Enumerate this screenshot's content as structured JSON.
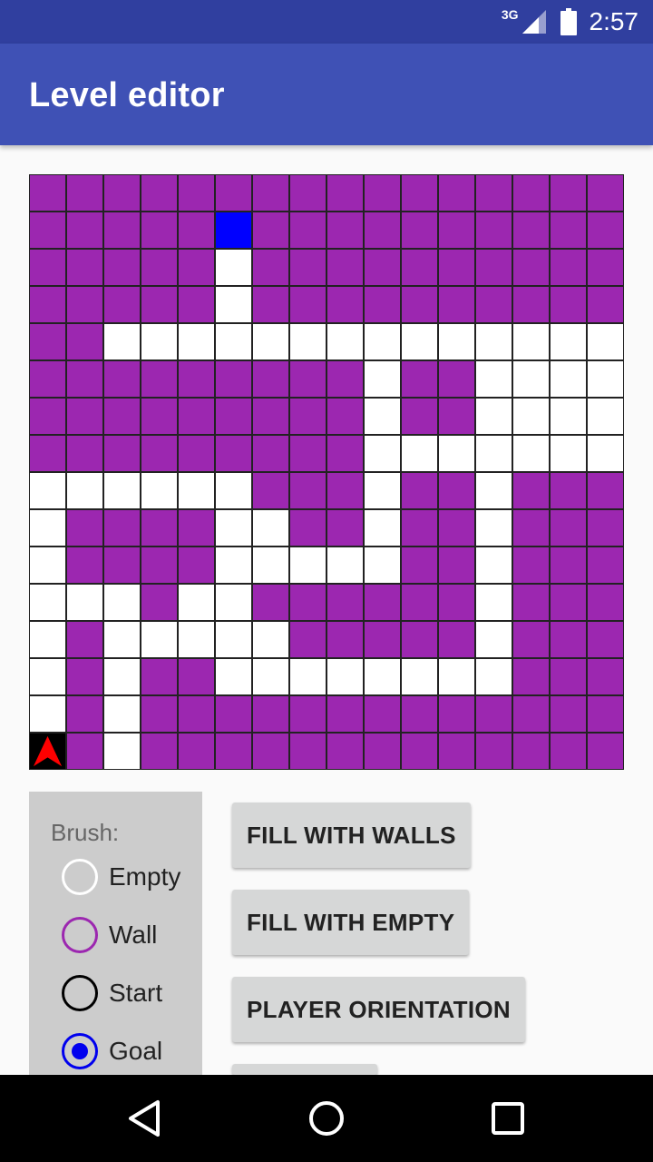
{
  "status_bar": {
    "network": "3G",
    "time": "2:57"
  },
  "app_bar": {
    "title": "Level editor"
  },
  "maze": {
    "rows": 16,
    "cols": 16,
    "legend": {
      "W": "wall",
      "E": "empty",
      "G": "goal",
      "S": "start"
    },
    "start_orientation": "up",
    "colors": {
      "wall": "#9c27b0",
      "empty": "#ffffff",
      "goal": "#0000ff",
      "start": "#000000",
      "arrow": "#ff0000"
    },
    "cells": [
      "WWWWWWWWWWWWWWWW",
      "WWWWWGWWWWWWWWWW",
      "WWWWWEWWWWWWWWWW",
      "WWWWWEWWWWWWWWWW",
      "WWEEEEEEEEEEEEEE",
      "WWWWWWWWWEWWEEEE",
      "WWWWWWWWWEWWEEEE",
      "WWWWWWWWWEEEEEEE",
      "EEEEEEWWWEWWEWWW",
      "EWWWWEEWWEWWEWWW",
      "EWWWWEEEEEWWEWWW",
      "EEEWEEWWWWWWEWWW",
      "EWEEEEEWWWWWEWWW",
      "EWEWWEEEEEEEEWWW",
      "EWEWWWWWWWWWWWWW",
      "SWEWWWWWWWWWWWWW"
    ]
  },
  "brush": {
    "label": "Brush:",
    "options": [
      {
        "label": "Empty",
        "ring_color": "#ffffff",
        "selected": false
      },
      {
        "label": "Wall",
        "ring_color": "#9c27b0",
        "selected": false
      },
      {
        "label": "Start",
        "ring_color": "#000000",
        "selected": false
      },
      {
        "label": "Goal",
        "ring_color": "#0000ee",
        "selected": true
      }
    ]
  },
  "buttons": {
    "fill_walls": "FILL WITH WALLS",
    "fill_empty": "FILL WITH EMPTY",
    "player_orientation": "PLAYER ORIENTATION"
  },
  "nav_bar": {
    "icons": [
      "back-icon",
      "home-icon",
      "recents-icon"
    ]
  }
}
